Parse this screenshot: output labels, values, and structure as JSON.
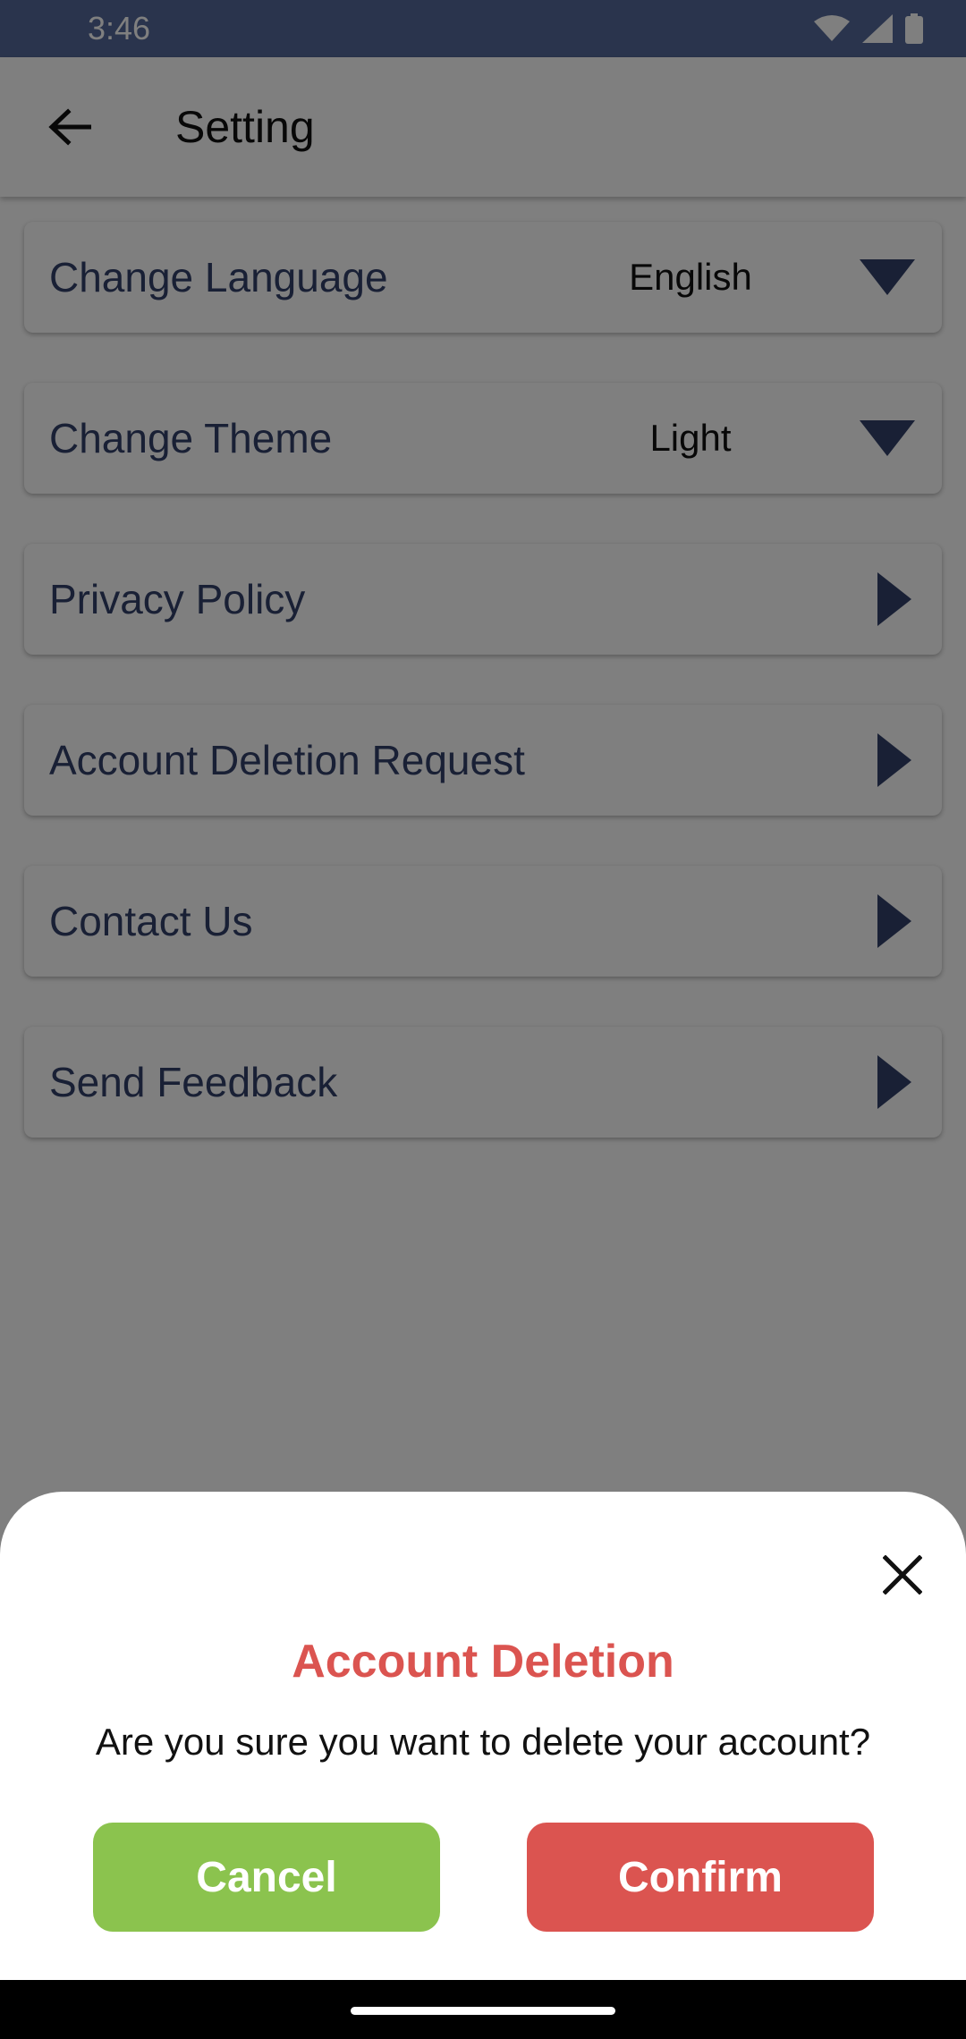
{
  "status_bar": {
    "time": "3:46"
  },
  "app_bar": {
    "title": "Setting"
  },
  "settings": [
    {
      "label": "Change Language",
      "value": "English",
      "control": "dropdown"
    },
    {
      "label": "Change Theme",
      "value": "Light",
      "control": "dropdown"
    },
    {
      "label": "Privacy Policy",
      "control": "chevron"
    },
    {
      "label": "Account Deletion Request",
      "control": "chevron"
    },
    {
      "label": "Contact Us",
      "control": "chevron"
    },
    {
      "label": "Send Feedback",
      "control": "chevron"
    }
  ],
  "dialog": {
    "title": "Account Deletion",
    "message": "Are you sure you want to delete your account?",
    "cancel_label": "Cancel",
    "confirm_label": "Confirm"
  },
  "colors": {
    "status_bar": "#55699a",
    "label_text": "#33406b",
    "icon": "#33406b",
    "danger": "#db5450",
    "success": "#8bc34e"
  }
}
